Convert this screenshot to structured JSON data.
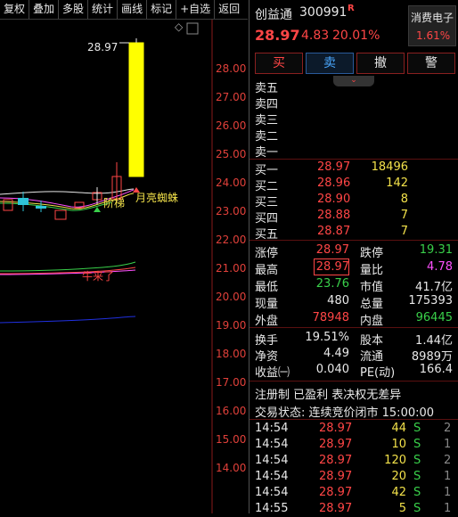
{
  "toolbar": {
    "items": [
      "复权",
      "叠加",
      "多股",
      "统计",
      "画线",
      "标记",
      "+自选",
      "返回"
    ]
  },
  "chart": {
    "price_label": "28.97",
    "annotations": {
      "a1": "阶梯",
      "a2": "月亮蜘蛛",
      "a3": "牛来了"
    },
    "y_ticks": [
      "28.00",
      "27.00",
      "26.00",
      "25.00",
      "24.00",
      "23.00",
      "22.00",
      "21.00",
      "20.00",
      "19.00",
      "18.00",
      "17.00",
      "16.00",
      "15.00",
      "14.00"
    ],
    "diamond": "◇"
  },
  "quote": {
    "name": "创益通",
    "code": "300991",
    "flag": "R",
    "price": "28.97",
    "change": "4.83",
    "pct": "20.01%",
    "sector_name": "消费电子",
    "sector_pct": "1.61%"
  },
  "tabs": {
    "buy": "买",
    "sell": "卖",
    "cancel": "撤",
    "alert": "警"
  },
  "asks": [
    {
      "label": "卖五",
      "price": "",
      "vol": ""
    },
    {
      "label": "卖四",
      "price": "",
      "vol": ""
    },
    {
      "label": "卖三",
      "price": "",
      "vol": ""
    },
    {
      "label": "卖二",
      "price": "",
      "vol": ""
    },
    {
      "label": "卖一",
      "price": "",
      "vol": ""
    }
  ],
  "bids": [
    {
      "label": "买一",
      "price": "28.97",
      "vol": "18496"
    },
    {
      "label": "买二",
      "price": "28.96",
      "vol": "142"
    },
    {
      "label": "买三",
      "price": "28.90",
      "vol": "8"
    },
    {
      "label": "买四",
      "price": "28.88",
      "vol": "7"
    },
    {
      "label": "买五",
      "price": "28.87",
      "vol": "7"
    }
  ],
  "stats": {
    "limit_up_label": "涨停",
    "limit_up": "28.97",
    "limit_down_label": "跌停",
    "limit_down": "19.31",
    "high_label": "最高",
    "high": "28.97",
    "vol_ratio_label": "量比",
    "vol_ratio": "4.78",
    "low_label": "最低",
    "low": "23.76",
    "mcap_label": "市值",
    "mcap": "41.7亿",
    "now_vol_label": "现量",
    "now_vol": "480",
    "total_vol_label": "总量",
    "total_vol": "175393",
    "outer_label": "外盘",
    "outer": "78948",
    "inner_label": "内盘",
    "inner": "96445",
    "turnover_label": "换手",
    "turnover": "19.51%",
    "equity_label": "股本",
    "equity": "1.44亿",
    "nav_label": "净资",
    "nav": "4.49",
    "float_label": "流通",
    "float": "8989万",
    "eps_label": "收益㈠",
    "eps": "0.040",
    "pe_label": "PE(动)",
    "pe": "166.4"
  },
  "notes": {
    "line1": "注册制 已盈利 表决权无差异",
    "line2": "交易状态: 连续竞价闭市 15:00:00"
  },
  "ticks": [
    {
      "time": "14:54",
      "price": "28.97",
      "vol": "44",
      "side": "S",
      "n": "2"
    },
    {
      "time": "14:54",
      "price": "28.97",
      "vol": "10",
      "side": "S",
      "n": "1"
    },
    {
      "time": "14:54",
      "price": "28.97",
      "vol": "120",
      "side": "S",
      "n": "2"
    },
    {
      "time": "14:54",
      "price": "28.97",
      "vol": "20",
      "side": "S",
      "n": "1"
    },
    {
      "time": "14:54",
      "price": "28.97",
      "vol": "42",
      "side": "S",
      "n": "1"
    },
    {
      "time": "14:55",
      "price": "28.97",
      "vol": "5",
      "side": "S",
      "n": "1"
    }
  ]
}
